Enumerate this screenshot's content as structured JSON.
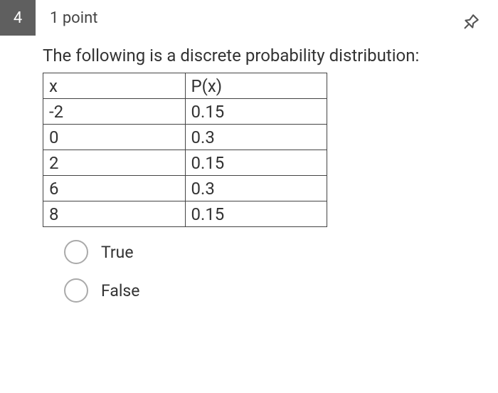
{
  "question": {
    "number": "4",
    "points": "1 point",
    "prompt": "The following is a discrete probability distribution:",
    "table": {
      "headers": [
        "x",
        "P(x)"
      ],
      "rows": [
        [
          "-2",
          "0.15"
        ],
        [
          "0",
          "0.3"
        ],
        [
          "2",
          "0.15"
        ],
        [
          "6",
          "0.3"
        ],
        [
          "8",
          "0.15"
        ]
      ]
    },
    "options": [
      {
        "label": "True"
      },
      {
        "label": "False"
      }
    ]
  }
}
